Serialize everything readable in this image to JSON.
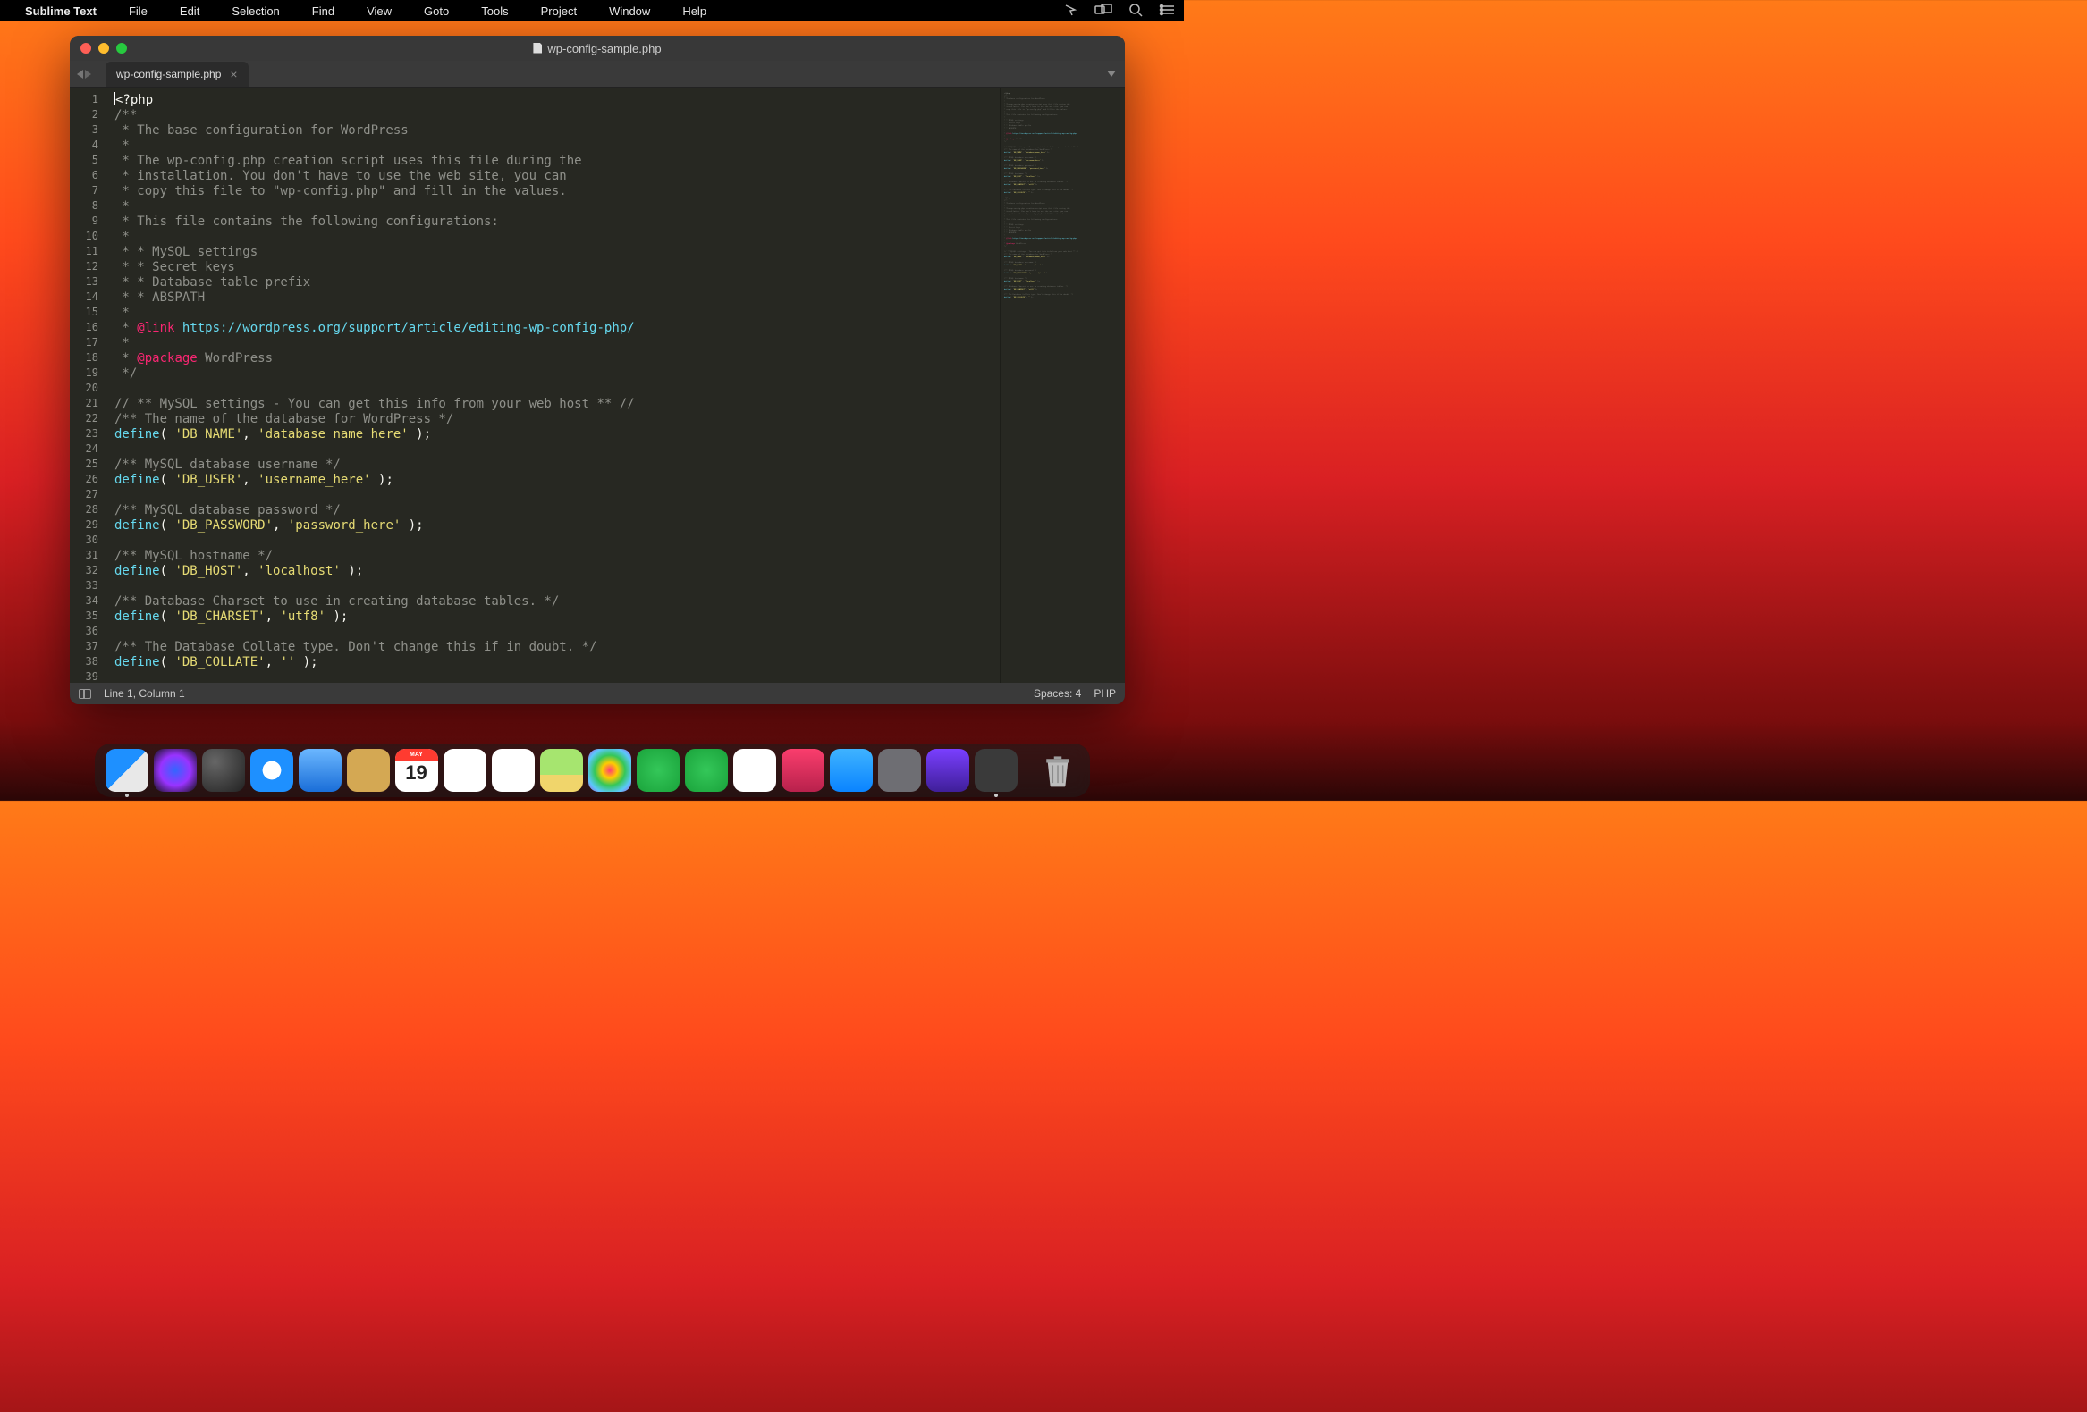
{
  "menubar": {
    "app": "Sublime Text",
    "items": [
      "File",
      "Edit",
      "Selection",
      "Find",
      "View",
      "Goto",
      "Tools",
      "Project",
      "Window",
      "Help"
    ]
  },
  "window": {
    "title": "wp-config-sample.php",
    "tab": "wp-config-sample.php"
  },
  "status": {
    "pos": "Line 1, Column 1",
    "spaces": "Spaces: 4",
    "lang": "PHP"
  },
  "calendar": {
    "month": "MAY",
    "day": "19"
  },
  "code": {
    "tokensPerLine": [
      [
        [
          "w",
          "<?php"
        ]
      ],
      [
        [
          "c",
          "/**"
        ]
      ],
      [
        [
          "c",
          " * The base configuration for WordPress"
        ]
      ],
      [
        [
          "c",
          " *"
        ]
      ],
      [
        [
          "c",
          " * The wp-config.php creation script uses this file during the"
        ]
      ],
      [
        [
          "c",
          " * installation. You don't have to use the web site, you can"
        ]
      ],
      [
        [
          "c",
          " * copy this file to \"wp-config.php\" and fill in the values."
        ]
      ],
      [
        [
          "c",
          " *"
        ]
      ],
      [
        [
          "c",
          " * This file contains the following configurations:"
        ]
      ],
      [
        [
          "c",
          " *"
        ]
      ],
      [
        [
          "c",
          " * * MySQL settings"
        ]
      ],
      [
        [
          "c",
          " * * Secret keys"
        ]
      ],
      [
        [
          "c",
          " * * Database table prefix"
        ]
      ],
      [
        [
          "c",
          " * * ABSPATH"
        ]
      ],
      [
        [
          "c",
          " *"
        ]
      ],
      [
        [
          "c",
          " * "
        ],
        [
          "tag",
          "@link"
        ],
        [
          "c",
          " "
        ],
        [
          "link",
          "https://wordpress.org/support/article/editing-wp-config-php/"
        ]
      ],
      [
        [
          "c",
          " *"
        ]
      ],
      [
        [
          "c",
          " * "
        ],
        [
          "tag",
          "@package"
        ],
        [
          "c",
          " WordPress"
        ]
      ],
      [
        [
          "c",
          " */"
        ]
      ],
      [],
      [
        [
          "c",
          "// ** MySQL settings - You can get this info from your web host ** //"
        ]
      ],
      [
        [
          "c",
          "/** The name of the database for WordPress */"
        ]
      ],
      [
        [
          "kw",
          "define"
        ],
        [
          "w",
          "( "
        ],
        [
          "str",
          "'DB_NAME'"
        ],
        [
          "w",
          ", "
        ],
        [
          "str",
          "'database_name_here'"
        ],
        [
          "w",
          " );"
        ]
      ],
      [],
      [
        [
          "c",
          "/** MySQL database username */"
        ]
      ],
      [
        [
          "kw",
          "define"
        ],
        [
          "w",
          "( "
        ],
        [
          "str",
          "'DB_USER'"
        ],
        [
          "w",
          ", "
        ],
        [
          "str",
          "'username_here'"
        ],
        [
          "w",
          " );"
        ]
      ],
      [],
      [
        [
          "c",
          "/** MySQL database password */"
        ]
      ],
      [
        [
          "kw",
          "define"
        ],
        [
          "w",
          "( "
        ],
        [
          "str",
          "'DB_PASSWORD'"
        ],
        [
          "w",
          ", "
        ],
        [
          "str",
          "'password_here'"
        ],
        [
          "w",
          " );"
        ]
      ],
      [],
      [
        [
          "c",
          "/** MySQL hostname */"
        ]
      ],
      [
        [
          "kw",
          "define"
        ],
        [
          "w",
          "( "
        ],
        [
          "str",
          "'DB_HOST'"
        ],
        [
          "w",
          ", "
        ],
        [
          "str",
          "'localhost'"
        ],
        [
          "w",
          " );"
        ]
      ],
      [],
      [
        [
          "c",
          "/** Database Charset to use in creating database tables. */"
        ]
      ],
      [
        [
          "kw",
          "define"
        ],
        [
          "w",
          "( "
        ],
        [
          "str",
          "'DB_CHARSET'"
        ],
        [
          "w",
          ", "
        ],
        [
          "str",
          "'utf8'"
        ],
        [
          "w",
          " );"
        ]
      ],
      [],
      [
        [
          "c",
          "/** The Database Collate type. Don't change this if in doubt. */"
        ]
      ],
      [
        [
          "kw",
          "define"
        ],
        [
          "w",
          "( "
        ],
        [
          "str",
          "'DB_COLLATE'"
        ],
        [
          "w",
          ", "
        ],
        [
          "str",
          "''"
        ],
        [
          "w",
          " );"
        ]
      ],
      []
    ]
  },
  "dock": [
    {
      "name": "finder",
      "cls": "di-finder",
      "running": true
    },
    {
      "name": "siri",
      "cls": "di-siri"
    },
    {
      "name": "launchpad",
      "cls": "di-launch"
    },
    {
      "name": "safari",
      "cls": "di-safari"
    },
    {
      "name": "mail",
      "cls": "di-mail"
    },
    {
      "name": "contacts",
      "cls": "di-contacts"
    },
    {
      "name": "calendar",
      "cls": "di-cal",
      "calendar": true
    },
    {
      "name": "notes",
      "cls": "di-notes"
    },
    {
      "name": "reminders",
      "cls": "di-remind"
    },
    {
      "name": "maps",
      "cls": "di-maps"
    },
    {
      "name": "photos",
      "cls": "di-photos"
    },
    {
      "name": "messages",
      "cls": "di-msg"
    },
    {
      "name": "facetime",
      "cls": "di-ft"
    },
    {
      "name": "news",
      "cls": "di-news"
    },
    {
      "name": "music",
      "cls": "di-music"
    },
    {
      "name": "appstore",
      "cls": "di-appstore"
    },
    {
      "name": "system-preferences",
      "cls": "di-prefs"
    },
    {
      "name": "wallpaper",
      "cls": "di-wall"
    },
    {
      "name": "sublime-text",
      "cls": "di-sublime",
      "running": true
    }
  ]
}
